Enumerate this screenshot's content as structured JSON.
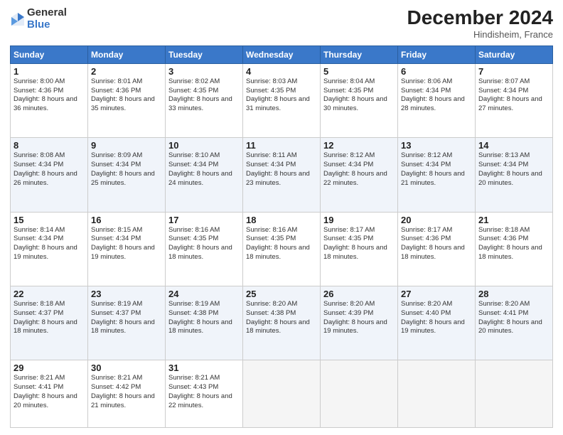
{
  "logo": {
    "general": "General",
    "blue": "Blue"
  },
  "header": {
    "month": "December 2024",
    "location": "Hindisheim, France"
  },
  "weekdays": [
    "Sunday",
    "Monday",
    "Tuesday",
    "Wednesday",
    "Thursday",
    "Friday",
    "Saturday"
  ],
  "weeks": [
    [
      {
        "day": "1",
        "sunrise": "8:00 AM",
        "sunset": "4:36 PM",
        "daylight": "8 hours and 36 minutes."
      },
      {
        "day": "2",
        "sunrise": "8:01 AM",
        "sunset": "4:36 PM",
        "daylight": "8 hours and 35 minutes."
      },
      {
        "day": "3",
        "sunrise": "8:02 AM",
        "sunset": "4:35 PM",
        "daylight": "8 hours and 33 minutes."
      },
      {
        "day": "4",
        "sunrise": "8:03 AM",
        "sunset": "4:35 PM",
        "daylight": "8 hours and 31 minutes."
      },
      {
        "day": "5",
        "sunrise": "8:04 AM",
        "sunset": "4:35 PM",
        "daylight": "8 hours and 30 minutes."
      },
      {
        "day": "6",
        "sunrise": "8:06 AM",
        "sunset": "4:34 PM",
        "daylight": "8 hours and 28 minutes."
      },
      {
        "day": "7",
        "sunrise": "8:07 AM",
        "sunset": "4:34 PM",
        "daylight": "8 hours and 27 minutes."
      }
    ],
    [
      {
        "day": "8",
        "sunrise": "8:08 AM",
        "sunset": "4:34 PM",
        "daylight": "8 hours and 26 minutes."
      },
      {
        "day": "9",
        "sunrise": "8:09 AM",
        "sunset": "4:34 PM",
        "daylight": "8 hours and 25 minutes."
      },
      {
        "day": "10",
        "sunrise": "8:10 AM",
        "sunset": "4:34 PM",
        "daylight": "8 hours and 24 minutes."
      },
      {
        "day": "11",
        "sunrise": "8:11 AM",
        "sunset": "4:34 PM",
        "daylight": "8 hours and 23 minutes."
      },
      {
        "day": "12",
        "sunrise": "8:12 AM",
        "sunset": "4:34 PM",
        "daylight": "8 hours and 22 minutes."
      },
      {
        "day": "13",
        "sunrise": "8:12 AM",
        "sunset": "4:34 PM",
        "daylight": "8 hours and 21 minutes."
      },
      {
        "day": "14",
        "sunrise": "8:13 AM",
        "sunset": "4:34 PM",
        "daylight": "8 hours and 20 minutes."
      }
    ],
    [
      {
        "day": "15",
        "sunrise": "8:14 AM",
        "sunset": "4:34 PM",
        "daylight": "8 hours and 19 minutes."
      },
      {
        "day": "16",
        "sunrise": "8:15 AM",
        "sunset": "4:34 PM",
        "daylight": "8 hours and 19 minutes."
      },
      {
        "day": "17",
        "sunrise": "8:16 AM",
        "sunset": "4:35 PM",
        "daylight": "8 hours and 18 minutes."
      },
      {
        "day": "18",
        "sunrise": "8:16 AM",
        "sunset": "4:35 PM",
        "daylight": "8 hours and 18 minutes."
      },
      {
        "day": "19",
        "sunrise": "8:17 AM",
        "sunset": "4:35 PM",
        "daylight": "8 hours and 18 minutes."
      },
      {
        "day": "20",
        "sunrise": "8:17 AM",
        "sunset": "4:36 PM",
        "daylight": "8 hours and 18 minutes."
      },
      {
        "day": "21",
        "sunrise": "8:18 AM",
        "sunset": "4:36 PM",
        "daylight": "8 hours and 18 minutes."
      }
    ],
    [
      {
        "day": "22",
        "sunrise": "8:18 AM",
        "sunset": "4:37 PM",
        "daylight": "8 hours and 18 minutes."
      },
      {
        "day": "23",
        "sunrise": "8:19 AM",
        "sunset": "4:37 PM",
        "daylight": "8 hours and 18 minutes."
      },
      {
        "day": "24",
        "sunrise": "8:19 AM",
        "sunset": "4:38 PM",
        "daylight": "8 hours and 18 minutes."
      },
      {
        "day": "25",
        "sunrise": "8:20 AM",
        "sunset": "4:38 PM",
        "daylight": "8 hours and 18 minutes."
      },
      {
        "day": "26",
        "sunrise": "8:20 AM",
        "sunset": "4:39 PM",
        "daylight": "8 hours and 19 minutes."
      },
      {
        "day": "27",
        "sunrise": "8:20 AM",
        "sunset": "4:40 PM",
        "daylight": "8 hours and 19 minutes."
      },
      {
        "day": "28",
        "sunrise": "8:20 AM",
        "sunset": "4:41 PM",
        "daylight": "8 hours and 20 minutes."
      }
    ],
    [
      {
        "day": "29",
        "sunrise": "8:21 AM",
        "sunset": "4:41 PM",
        "daylight": "8 hours and 20 minutes."
      },
      {
        "day": "30",
        "sunrise": "8:21 AM",
        "sunset": "4:42 PM",
        "daylight": "8 hours and 21 minutes."
      },
      {
        "day": "31",
        "sunrise": "8:21 AM",
        "sunset": "4:43 PM",
        "daylight": "8 hours and 22 minutes."
      },
      null,
      null,
      null,
      null
    ]
  ]
}
